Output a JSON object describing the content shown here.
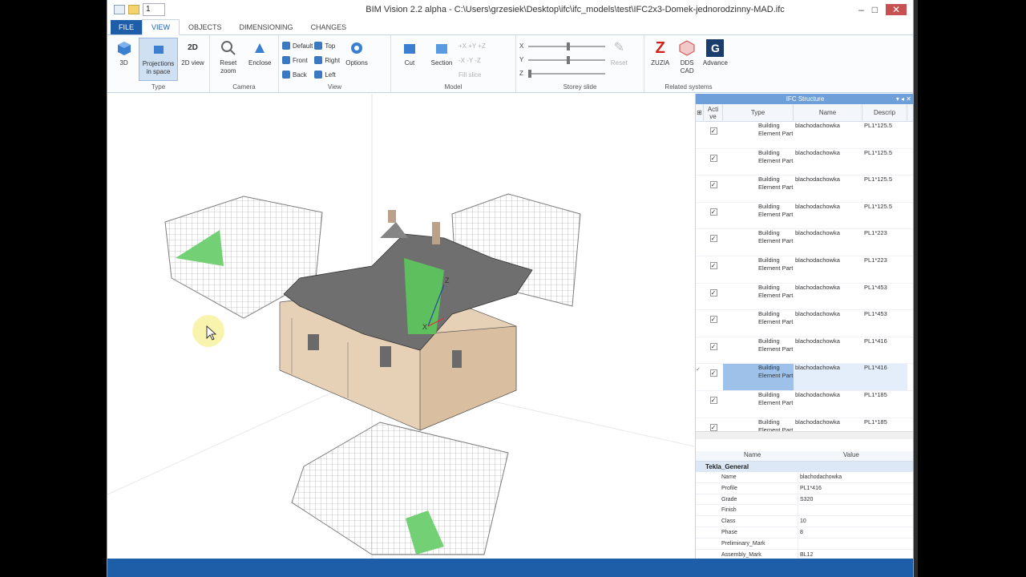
{
  "titlebar": {
    "spin_value": "1",
    "title": "BIM Vision 2.2 alpha - C:\\Users\\grzesiek\\Desktop\\ifc\\ifc_models\\test\\IFC2x3-Domek-jednorodzinny-MAD.ifc",
    "minimize": "–",
    "maximize": "□",
    "close": "✕"
  },
  "tabs": {
    "file": "FILE",
    "view": "VIEW",
    "objects": "OBJECTS",
    "dimensioning": "DIMENSIONING",
    "changes": "CHANGES"
  },
  "ribbon": {
    "type": {
      "label": "Type",
      "btn_3d": "3D",
      "btn_proj": "Projections in space",
      "btn_2d": "2D view"
    },
    "camera": {
      "label": "Camera",
      "reset": "Reset zoom",
      "enclose": "Enclose"
    },
    "view": {
      "label": "View",
      "default": "Default",
      "front": "Front",
      "back": "Back",
      "top": "Top",
      "right": "Right",
      "left": "Left",
      "options": "Options"
    },
    "model": {
      "label": "Model",
      "cut": "Cut",
      "section": "Section",
      "axis1": "+X +Y +Z",
      "axis2": "-X -Y -Z",
      "fill": "Fill slice"
    },
    "storey": {
      "label": "Storey slide",
      "x": "X",
      "y": "Y",
      "z": "Z",
      "reset": "Reset"
    },
    "related": {
      "label": "Related systems",
      "zuzia": "ZUZIA",
      "dds": "DDS CAD",
      "advance": "Advance"
    }
  },
  "ifc": {
    "title": "IFC Structure",
    "col_active": "Acti ve",
    "col_type": "Type",
    "col_name": "Name",
    "col_desc": "Descrip",
    "rows": [
      {
        "type": "Building Element Part",
        "name": "blachodachowka",
        "desc": "PL1*125.5"
      },
      {
        "type": "Building Element Part",
        "name": "blachodachowka",
        "desc": "PL1*125.5"
      },
      {
        "type": "Building Element Part",
        "name": "blachodachowka",
        "desc": "PL1*125.5"
      },
      {
        "type": "Building Element Part",
        "name": "blachodachowka",
        "desc": "PL1*125.5"
      },
      {
        "type": "Building Element Part",
        "name": "blachodachowka",
        "desc": "PL1*223"
      },
      {
        "type": "Building Element Part",
        "name": "blachodachowka",
        "desc": "PL1*223"
      },
      {
        "type": "Building Element Part",
        "name": "blachodachowka",
        "desc": "PL1*453"
      },
      {
        "type": "Building Element Part",
        "name": "blachodachowka",
        "desc": "PL1*453"
      },
      {
        "type": "Building Element Part",
        "name": "blachodachowka",
        "desc": "PL1*416"
      },
      {
        "type": "Building Element Part",
        "name": "blachodachowka",
        "desc": "PL1*416"
      },
      {
        "type": "Building Element Part",
        "name": "blachodachowka",
        "desc": "PL1*185"
      },
      {
        "type": "Building Element Part",
        "name": "blachodachowka",
        "desc": "PL1*185"
      }
    ]
  },
  "props": {
    "col_name": "Name",
    "col_value": "Value",
    "group": "Tekla_General",
    "rows": [
      {
        "n": "Name",
        "v": "blachodachowka"
      },
      {
        "n": "Profile",
        "v": "PL1*416"
      },
      {
        "n": "Grade",
        "v": "S320"
      },
      {
        "n": "Finish",
        "v": ""
      },
      {
        "n": "Class",
        "v": "10"
      },
      {
        "n": "Phase",
        "v": "8"
      },
      {
        "n": "Preliminary_Mark",
        "v": ""
      },
      {
        "n": "Assembly_Mark",
        "v": "BL12"
      }
    ]
  },
  "axes": {
    "x": "X",
    "z": "Z"
  }
}
